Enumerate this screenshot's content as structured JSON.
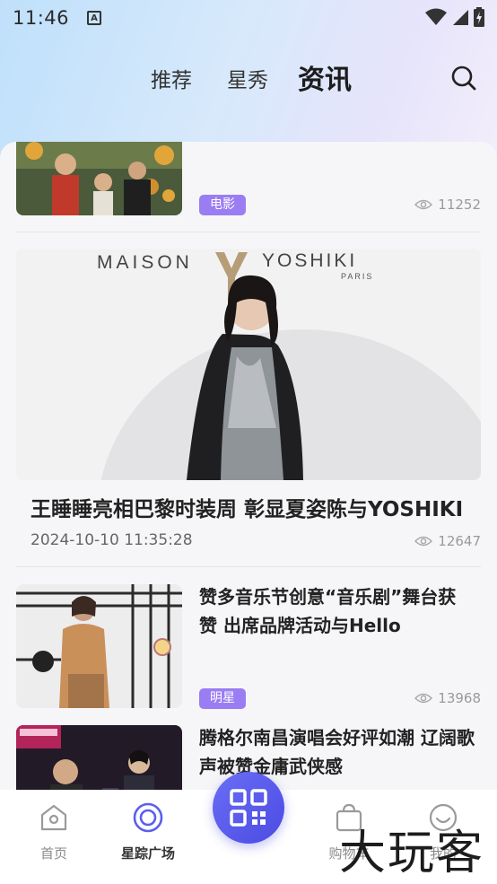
{
  "status_bar": {
    "time": "11:46",
    "notification_icon": "A"
  },
  "tabs": [
    {
      "label": "推荐",
      "active": false
    },
    {
      "label": "星秀",
      "active": false
    },
    {
      "label": "资讯",
      "active": true
    }
  ],
  "feed": {
    "item1": {
      "tag": "电影",
      "views": "11252"
    },
    "item2": {
      "title": "王睡睡亮相巴黎时装周 彰显夏姿陈与YOSHIKI",
      "date": "2024-10-10 11:35:28",
      "views": "12647",
      "banner_brand_left": "MAISON",
      "banner_brand_right": "YOSHIKI",
      "banner_sub": "PARIS"
    },
    "item3": {
      "title": "赞多音乐节创意“音乐剧”舞台获赞 出席品牌活动与Hello Kitty…",
      "tag": "明星",
      "views": "13968"
    },
    "item4": {
      "title": "腾格尔南昌演唱会好评如潮 辽阔歌声被赞金庸武侠感"
    }
  },
  "bottom_nav": [
    {
      "label": "首页",
      "icon": "home-icon",
      "active": false
    },
    {
      "label": "星踪广场",
      "icon": "circle-target-icon",
      "active": true
    },
    {
      "label": "购物车",
      "icon": "bag-icon",
      "active": false
    },
    {
      "label": "我的",
      "icon": "smile-icon",
      "active": false
    }
  ],
  "watermark": "大玩客",
  "colors": {
    "accent": "#9a7df2",
    "center_button": "#5a5cef",
    "nav_active": "#5b5ff0"
  }
}
